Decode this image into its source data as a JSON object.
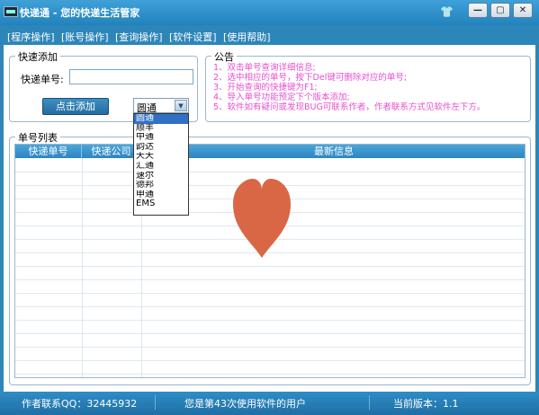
{
  "window": {
    "title": "快递通 - 您的快递生活管家",
    "controls": {
      "minimize": "—",
      "maximize": "▢",
      "close": "✕"
    }
  },
  "menu": [
    {
      "label": "[程序操作]"
    },
    {
      "label": "[账号操作]"
    },
    {
      "label": "[查询操作]"
    },
    {
      "label": "[软件设置]"
    },
    {
      "label": "[使用帮助]"
    }
  ],
  "quick_add": {
    "title": "快速添加",
    "number_label": "快递单号:",
    "number_value": "",
    "add_button": "点击添加",
    "company_selected": "圆通",
    "company_options": [
      "圆通",
      "顺丰",
      "中通",
      "韵达",
      "天天",
      "汇通",
      "速尔",
      "德邦",
      "申通",
      "EMS"
    ]
  },
  "notice": {
    "title": "公告",
    "lines": [
      "1、双击单号查询详细信息;",
      "2、选中相应的单号，按下Del键可删除对应的单号;",
      "3、开始查询的快捷键为F1;",
      "4、导入单号功能预定下个版本添加;",
      "5、软件如有疑问或发现BUG可联系作者，作者联系方式见软件左下方。"
    ]
  },
  "list": {
    "title": "单号列表",
    "columns": [
      "快递单号",
      "快递公司",
      "最新信息"
    ]
  },
  "status": {
    "contact": "作者联系QQ：32445932",
    "usage": "您是第43次使用软件的用户",
    "version": "当前版本：1.1"
  },
  "colors": {
    "accent": "#2f87b8",
    "heart": "#d96746",
    "notice_text": "#e64fd0"
  }
}
